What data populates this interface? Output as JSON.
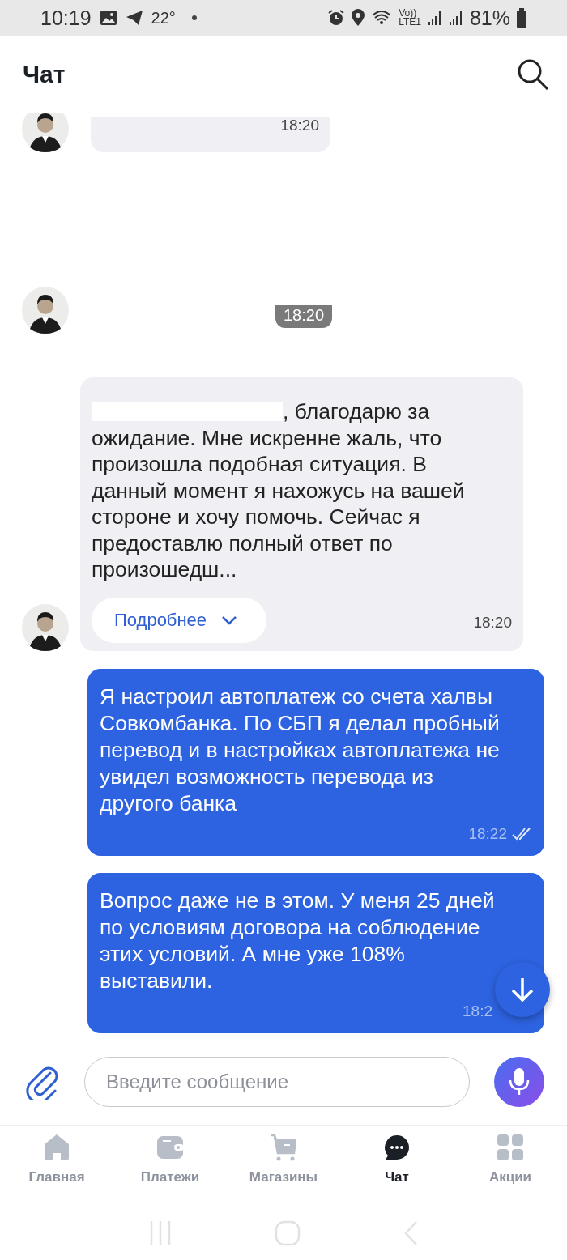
{
  "status_bar": {
    "time": "10:19",
    "temperature": "22°",
    "volte": "Vo))",
    "lte": "LTE1",
    "battery": "81%"
  },
  "header": {
    "title": "Чат"
  },
  "messages": [
    {
      "kind": "agent_cut",
      "time": "18:20"
    },
    {
      "kind": "agent_time",
      "time": "18:20"
    },
    {
      "kind": "agent",
      "redacted": true,
      "text": ", благодарю за ожидание. Мне искренне жаль, что произошла подобная ситуация. В данный момент я нахожусь на вашей стороне и хочу помочь. Сейчас я предоставлю полный ответ по произошедш...",
      "more": "Подробнее",
      "time": "18:20"
    },
    {
      "kind": "user",
      "text": "Я настроил автоплатеж со счета халвы Совкомбанка. По СБП я делал пробный перевод и в настройках автоплатежа не увидел возможность перевода из другого банка",
      "time": "18:22",
      "read": true
    },
    {
      "kind": "user",
      "text": "Вопрос даже не в этом. У меня 25 дней по условиям договора на соблюдение этих условий. А мне уже 108% выставили.",
      "time": "18:2",
      "read": false
    }
  ],
  "composer": {
    "placeholder": "Введите сообщение"
  },
  "nav": [
    {
      "label": "Главная",
      "kind": "home",
      "selected": false
    },
    {
      "label": "Платежи",
      "kind": "wallet",
      "selected": false
    },
    {
      "label": "Магазины",
      "kind": "cart",
      "selected": false
    },
    {
      "label": "Чат",
      "kind": "chat",
      "selected": true
    },
    {
      "label": "Акции",
      "kind": "grid",
      "selected": false
    }
  ]
}
